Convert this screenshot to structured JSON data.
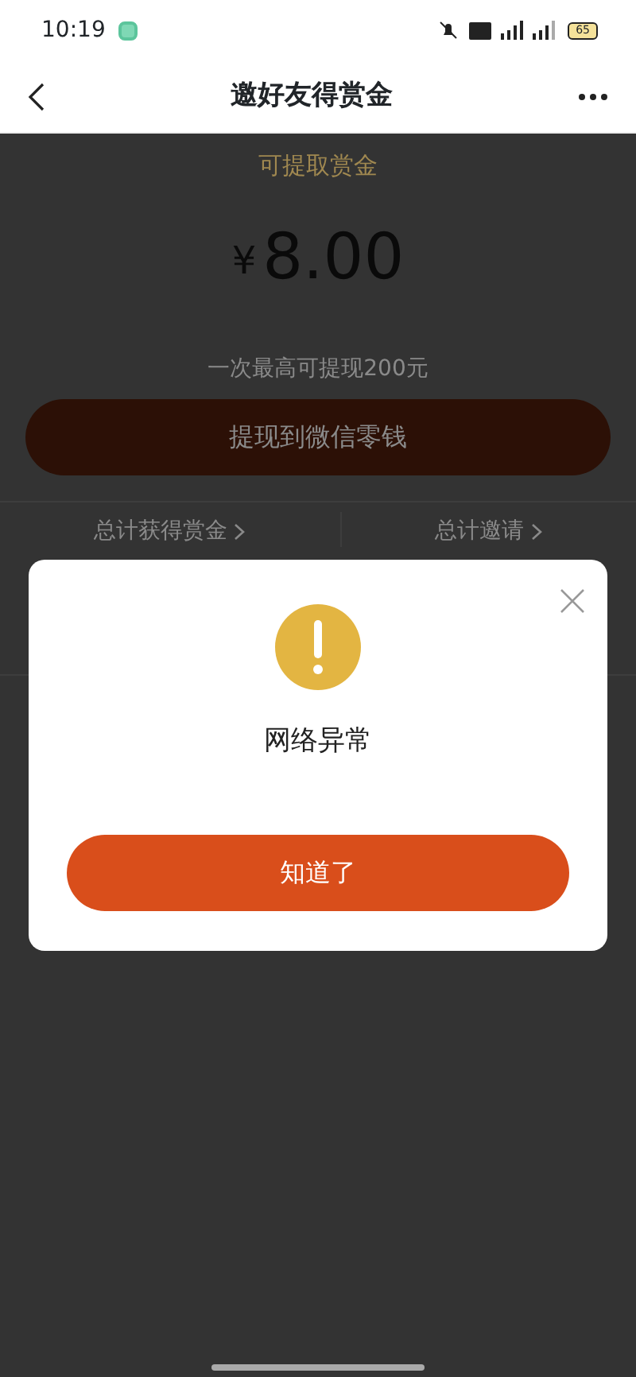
{
  "status_bar": {
    "time": "10:19",
    "battery": "65"
  },
  "header": {
    "title": "邀好友得赏金"
  },
  "balance": {
    "label": "可提取赏金",
    "currency": "¥",
    "amount": "8.00",
    "note": "一次最高可提现200元",
    "button": "提现到微信零钱"
  },
  "stats": [
    {
      "label": "总计获得赏金"
    },
    {
      "label": "总计邀请"
    }
  ],
  "dialog": {
    "message": "网络异常",
    "button": "知道了"
  }
}
